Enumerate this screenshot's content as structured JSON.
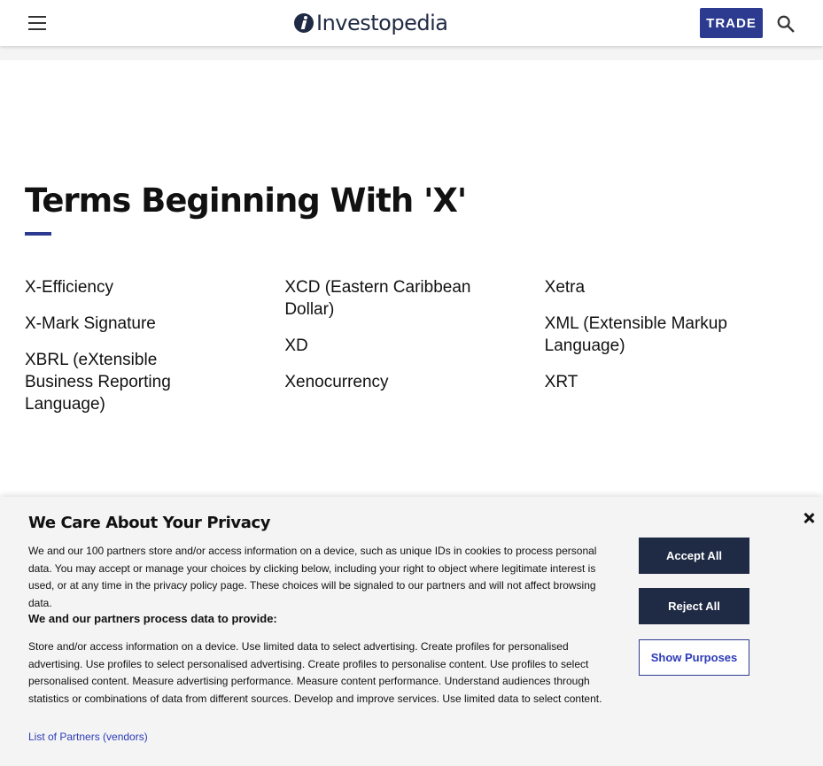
{
  "header": {
    "logo_text": "Investopedia",
    "trade_label": "TRADE",
    "icons": {
      "menu": "hamburger-menu-icon",
      "search": "search-icon",
      "logo": "investopedia-logo-icon"
    }
  },
  "main": {
    "title": "Terms Beginning With 'X'",
    "accent_color": "#2c3b8f",
    "columns": [
      [
        "X-Efficiency",
        "X-Mark Signature",
        "XBRL (eXtensible Business Reporting Language)"
      ],
      [
        "XCD (Eastern Caribbean Dollar)",
        "XD",
        "Xenocurrency"
      ],
      [
        "Xetra",
        "XML (Extensible Markup Language)",
        "XRT"
      ]
    ]
  },
  "privacy": {
    "title": "We Care About Your Privacy",
    "body": "We and our 100 partners store and/or access information on a device, such as unique IDs in cookies to process personal data. You may accept or manage your choices by clicking below, including your right to object where legitimate interest is used, or at any time in the privacy policy page. These choices will be signaled to our partners and will not affect browsing data.",
    "subhead": "We and our partners process data to provide:",
    "purposes": "Store and/or access information on a device. Use limited data to select advertising. Create profiles for personalised advertising. Use profiles to select personalised advertising. Create profiles to personalise content. Use profiles to select personalised content. Measure advertising performance. Measure content performance. Understand audiences through statistics or combinations of data from different sources. Develop and improve services. Use limited data to select content.",
    "partners_link": "List of Partners (vendors)",
    "accept_label": "Accept All",
    "reject_label": "Reject All",
    "purposes_label": "Show Purposes",
    "close_icon": "close-icon",
    "button_color": "#1f2a44"
  }
}
